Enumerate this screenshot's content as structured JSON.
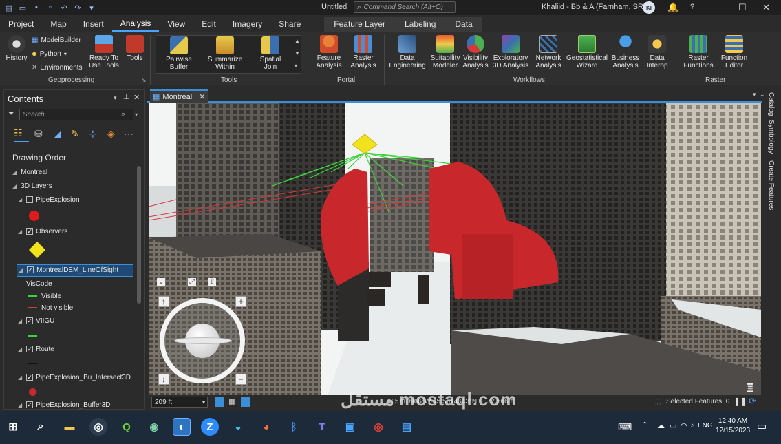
{
  "window": {
    "doc_title": "Untitled",
    "command_search_placeholder": "Command Search (Alt+Q)",
    "user": "Khaliid - Bb & A (Farnham, SRY)",
    "avatar_initials": "KI",
    "help": "?"
  },
  "ribbon": {
    "tabs": [
      "Project",
      "Map",
      "Insert",
      "Analysis",
      "View",
      "Edit",
      "Imagery",
      "Share"
    ],
    "active_tab": "Analysis",
    "context_tabs": [
      "Feature Layer",
      "Labeling",
      "Data"
    ],
    "geoprocessing": {
      "history": "History",
      "modelbuilder": "ModelBuilder",
      "python": "Python",
      "environments": "Environments",
      "ready_to_use": "Ready To Use Tools",
      "tools": "Tools",
      "group": "Geoprocessing"
    },
    "tools": {
      "pairwise_buffer": "Pairwise Buffer",
      "summarize_within": "Summarize Within",
      "spatial_join": "Spatial Join",
      "group": "Tools"
    },
    "portal": {
      "feature_analysis": "Feature Analysis",
      "raster_analysis": "Raster Analysis",
      "group": "Portal"
    },
    "workflows": {
      "data_engineering": "Data Engineering",
      "suitability_modeler": "Suitability Modeler",
      "visibility_analysis": "Visibility Analysis",
      "exploratory_3d": "Exploratory 3D Analysis",
      "network_analysis": "Network Analysis",
      "geostatistical_wizard": "Geostatistical Wizard",
      "business_analysis": "Business Analysis",
      "data_interop": "Data Interop",
      "group": "Workflows"
    },
    "raster": {
      "raster_functions": "Raster Functions",
      "function_editor": "Function Editor",
      "group": "Raster"
    }
  },
  "contents": {
    "title": "Contents",
    "search_placeholder": "Search",
    "drawing_order": "Drawing Order",
    "map_name": "Montreal",
    "group_3d": "3D Layers",
    "layers": [
      {
        "name": "PipeExplosion",
        "checked": false
      },
      {
        "name": "Observers",
        "checked": true
      },
      {
        "name": "MontrealDEM_LineOfSight",
        "checked": true
      },
      {
        "name": "VIIGU",
        "checked": true
      },
      {
        "name": "Route",
        "checked": true
      },
      {
        "name": "PipeExplosion_Bu_Intersect3D",
        "checked": true
      },
      {
        "name": "PipeExplosion_Buffer3D",
        "checked": true
      }
    ],
    "viscode_label": "VisCode",
    "visible_label": "Visible",
    "not_visible_label": "Not visible"
  },
  "map": {
    "tab_label": "Montreal",
    "scale": "209 ft",
    "coordinates": "73.5710966°W 45.5014643°N",
    "elevation": "77.566 ft",
    "selected_features": "Selected Features: 0"
  },
  "side_tabs": [
    "Catalog",
    "Symbology",
    "Create Features"
  ],
  "taskbar": {
    "language": "ENG",
    "time": "12:40 AM",
    "date": "12/15/2023"
  },
  "watermark": "مستقل mostaql.com",
  "colors": {
    "accent": "#3b8fd9",
    "visible_line": "#3dd13d",
    "not_visible_line": "#d33a3a",
    "observer": "#f2e21b",
    "buffer": "#c8282c"
  }
}
